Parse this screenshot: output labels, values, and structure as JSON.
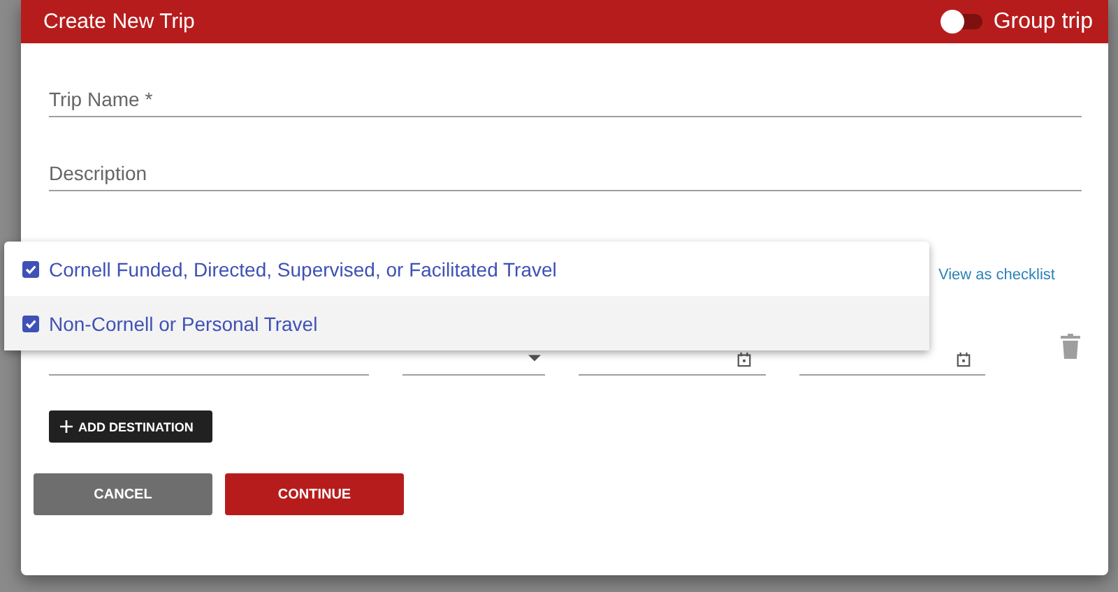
{
  "dialog": {
    "title": "Create New Trip",
    "group_trip": {
      "label": "Group trip",
      "on": false
    }
  },
  "fields": [
    {
      "placeholder": "Trip Name *"
    },
    {
      "placeholder": "Description"
    }
  ],
  "reason_menu": {
    "options": [
      {
        "label": "Cornell Funded, Directed, Supervised, or Facilitated Travel",
        "checked": true,
        "selected": false
      },
      {
        "label": "Non-Cornell or Personal Travel",
        "checked": true,
        "selected": true
      }
    ]
  },
  "view_checklist_link": "View as checklist",
  "destination_row": [
    {
      "kind": "text"
    },
    {
      "kind": "select"
    },
    {
      "kind": "date"
    },
    {
      "kind": "date"
    }
  ],
  "add_destination_button": "ADD DESTINATION",
  "buttons": [
    {
      "label": "CANCEL",
      "kind": "secondary"
    },
    {
      "label": "CONTINUE",
      "kind": "primary"
    }
  ]
}
